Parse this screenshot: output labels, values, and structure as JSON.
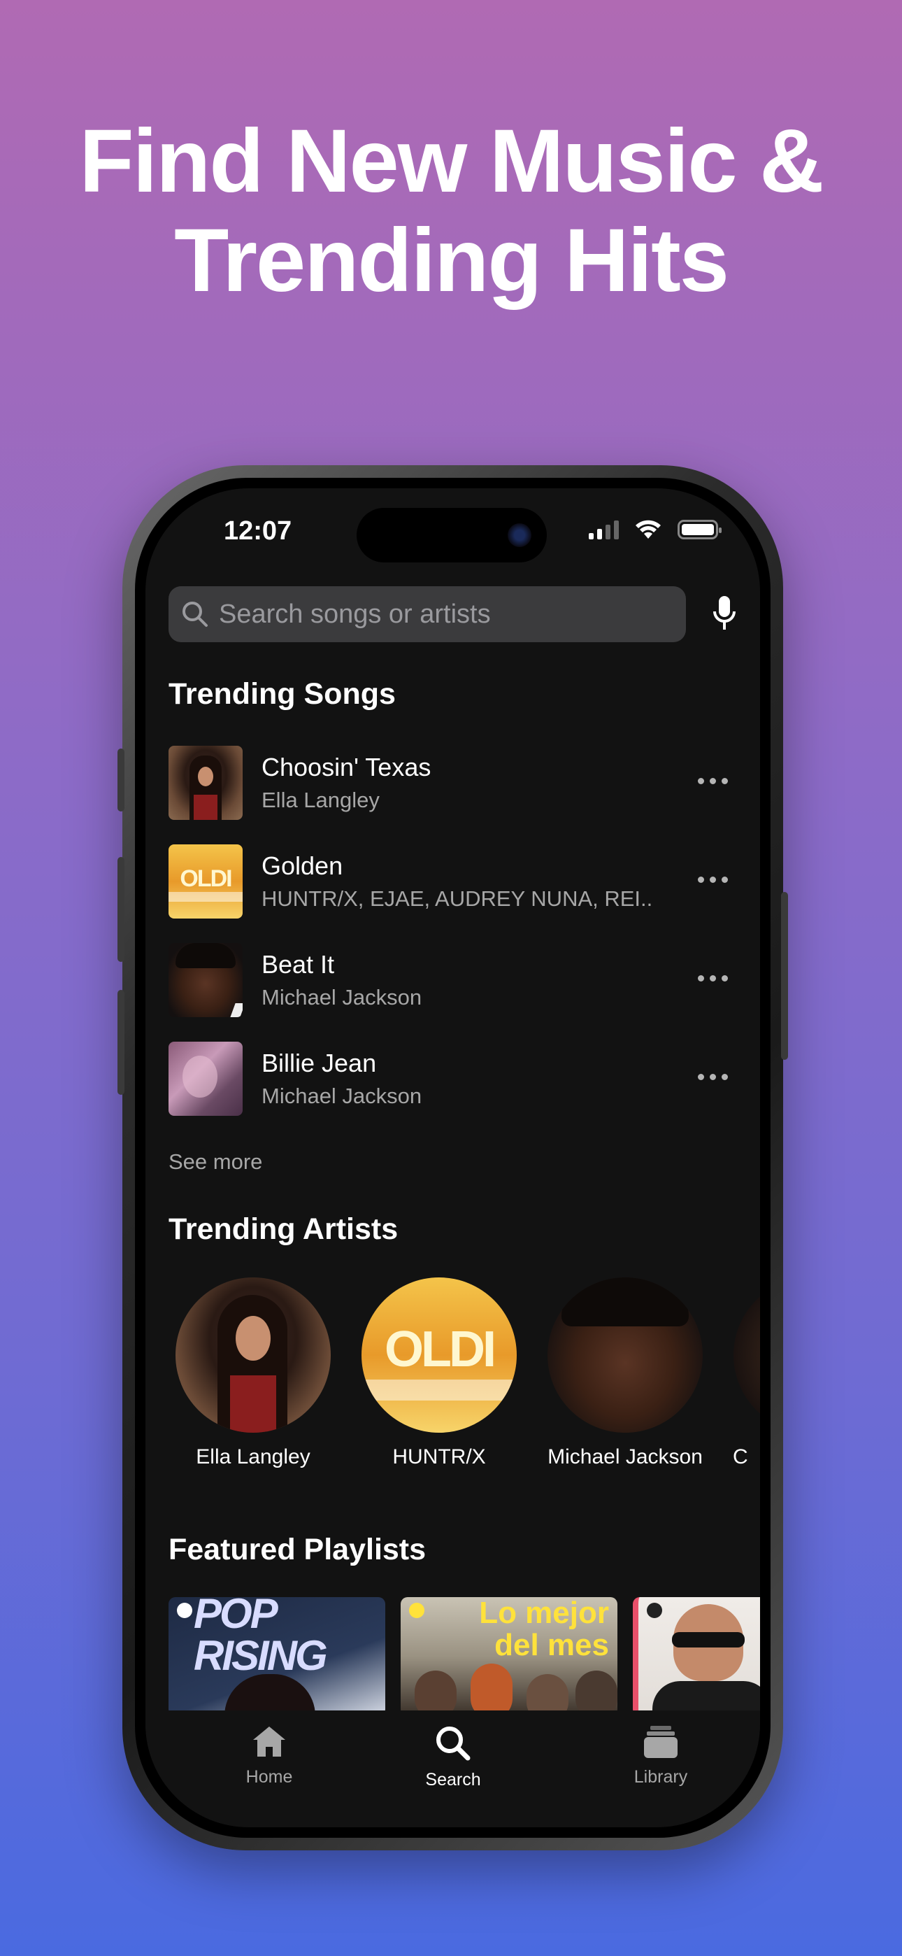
{
  "headline": {
    "line1": "Find New Music &",
    "line2": "Trending Hits"
  },
  "status_bar": {
    "time": "12:07",
    "icons": [
      "cellular-signal-icon",
      "wifi-icon",
      "battery-icon"
    ]
  },
  "search": {
    "placeholder": "Search songs or artists",
    "icon": "search-icon",
    "mic_icon": "microphone-icon"
  },
  "trending_songs": {
    "title": "Trending Songs",
    "items": [
      {
        "title": "Choosin' Texas",
        "artist": "Ella Langley"
      },
      {
        "title": "Golden",
        "artist": "HUNTR/X, EJAE, AUDREY NUNA, REI..."
      },
      {
        "title": "Beat It",
        "artist": "Michael Jackson"
      },
      {
        "title": "Billie Jean",
        "artist": "Michael Jackson"
      }
    ],
    "see_more": "See more"
  },
  "trending_artists": {
    "title": "Trending Artists",
    "items": [
      {
        "name": "Ella Langley"
      },
      {
        "name": "HUNTR/X"
      },
      {
        "name": "Michael Jackson"
      },
      {
        "name": "C"
      }
    ]
  },
  "featured_playlists": {
    "title": "Featured Playlists",
    "items": [
      {
        "label": "POP RISING"
      },
      {
        "label": "Lo mejor del mes"
      },
      {
        "label": ""
      }
    ]
  },
  "tab_bar": {
    "home": "Home",
    "search": "Search",
    "library": "Library",
    "active": "Search"
  },
  "colors": {
    "background_top": "#b06ab3",
    "background_bottom": "#4a6ae0",
    "screen": "#121212",
    "secondary_text": "#a7a7a7",
    "accent": "#ffe23b"
  }
}
